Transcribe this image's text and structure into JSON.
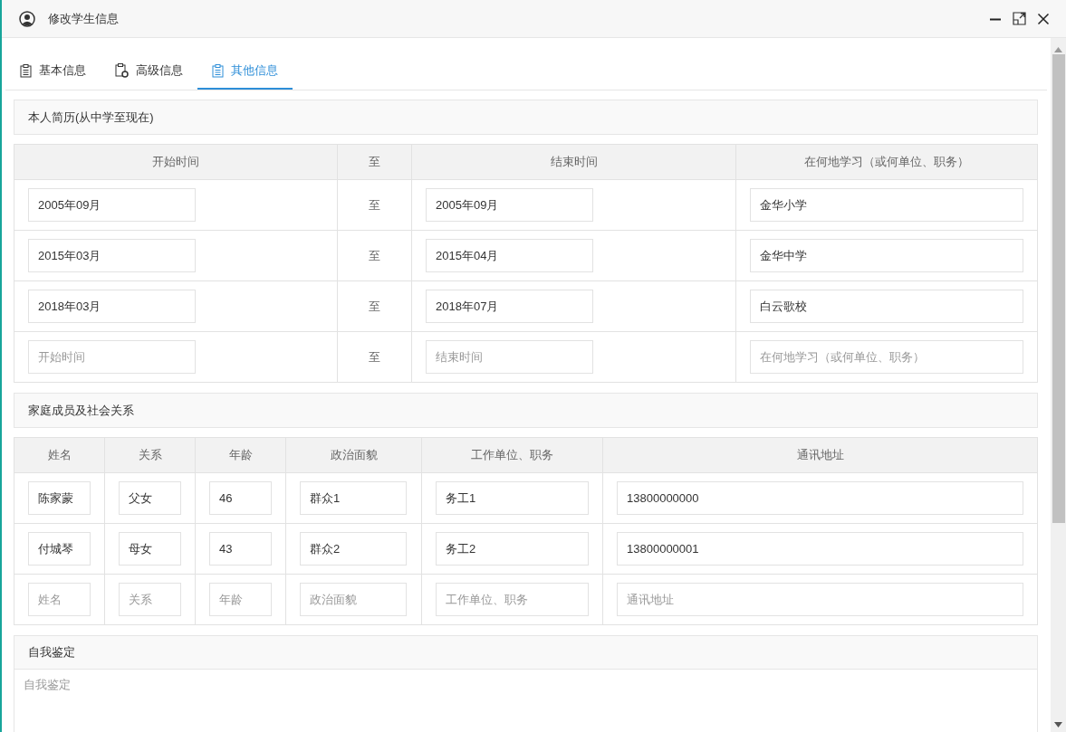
{
  "window": {
    "title": "修改学生信息"
  },
  "tabs": [
    {
      "label": "基本信息",
      "kind": "list",
      "selected": false
    },
    {
      "label": "高级信息",
      "kind": "settings",
      "selected": false
    },
    {
      "label": "其他信息",
      "kind": "list",
      "selected": true
    }
  ],
  "resume": {
    "title": "本人简历(从中学至现在)",
    "columns": [
      "开始时间",
      "至",
      "结束时间",
      "在何地学习（或何单位、职务）"
    ],
    "rows": [
      {
        "start": {
          "value": "2005年09月"
        },
        "to": "至",
        "end": {
          "value": "2005年09月"
        },
        "place": {
          "value": "金华小学"
        }
      },
      {
        "start": {
          "value": "2015年03月"
        },
        "to": "至",
        "end": {
          "value": "2015年04月"
        },
        "place": {
          "value": "金华中学"
        }
      },
      {
        "start": {
          "value": "2018年03月"
        },
        "to": "至",
        "end": {
          "value": "2018年07月"
        },
        "place": {
          "value": "白云歌校"
        }
      },
      {
        "start": {
          "placeholder": "开始时间"
        },
        "to": "至",
        "end": {
          "placeholder": "结束时间"
        },
        "place": {
          "placeholder": "在何地学习（或何单位、职务）"
        }
      }
    ]
  },
  "family": {
    "title": "家庭成员及社会关系",
    "columns": [
      "姓名",
      "关系",
      "年龄",
      "政治面貌",
      "工作单位、职务",
      "通讯地址"
    ],
    "rows": [
      [
        {
          "value": "陈家蒙"
        },
        {
          "value": "父女"
        },
        {
          "value": "46"
        },
        {
          "value": "群众1"
        },
        {
          "value": "务工1"
        },
        {
          "value": "13800000000"
        }
      ],
      [
        {
          "value": "付城琴"
        },
        {
          "value": "母女"
        },
        {
          "value": "43"
        },
        {
          "value": "群众2"
        },
        {
          "value": "务工2"
        },
        {
          "value": "13800000001"
        }
      ],
      [
        {
          "placeholder": "姓名"
        },
        {
          "placeholder": "关系"
        },
        {
          "placeholder": "年龄"
        },
        {
          "placeholder": "政治面貌"
        },
        {
          "placeholder": "工作单位、职务"
        },
        {
          "placeholder": "通讯地址"
        }
      ]
    ]
  },
  "self_evaluation": {
    "title": "自我鉴定",
    "placeholder": "自我鉴定"
  }
}
